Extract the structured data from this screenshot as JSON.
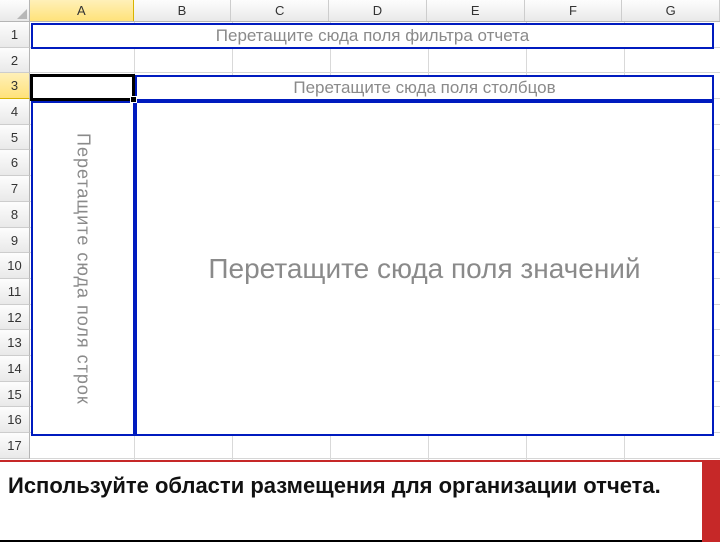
{
  "columns": [
    "A",
    "B",
    "C",
    "D",
    "E",
    "F",
    "G"
  ],
  "rows": [
    "1",
    "2",
    "3",
    "4",
    "5",
    "6",
    "7",
    "8",
    "9",
    "10",
    "11",
    "12",
    "13",
    "14",
    "15",
    "16",
    "17"
  ],
  "selected_row": "3",
  "selected_col": "A",
  "pivot": {
    "filter_hint": "Перетащите сюда поля фильтра отчета",
    "columns_hint": "Перетащите сюда поля столбцов",
    "rows_hint": "Перетащите сюда поля строк",
    "values_hint": "Перетащите сюда поля значений"
  },
  "caption": "Используйте области размещения для организации отчета."
}
